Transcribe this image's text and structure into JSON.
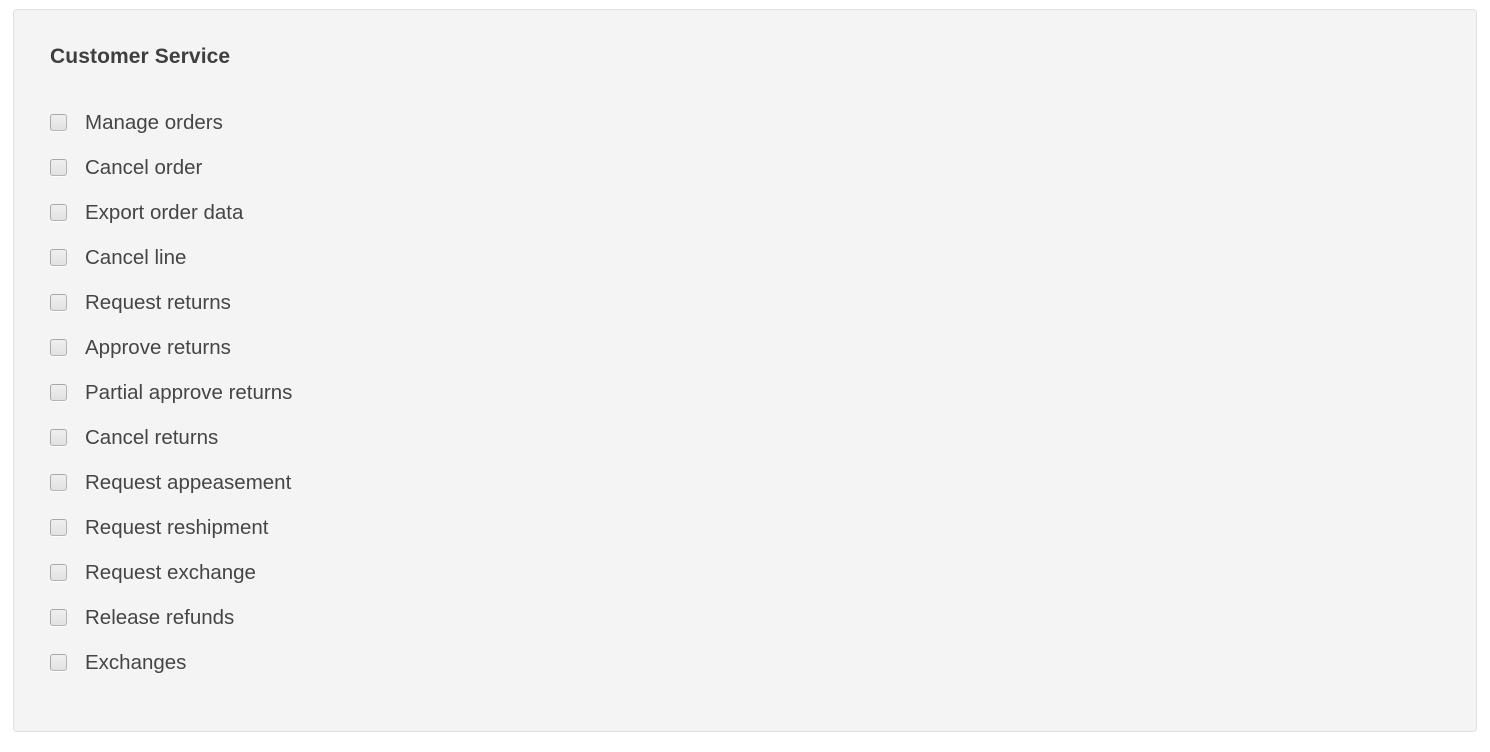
{
  "panel": {
    "title": "Customer Service",
    "background_color": "#f4f4f4",
    "border_color": "#e0e0e0",
    "title_color": "#3f3f3f",
    "label_color": "#454545",
    "checkbox_border_color": "#b4b4b4",
    "checkbox_fill_color": "#e6e6e6",
    "permissions": [
      {
        "label": "Manage orders",
        "checked": false
      },
      {
        "label": "Cancel order",
        "checked": false
      },
      {
        "label": "Export order data",
        "checked": false
      },
      {
        "label": "Cancel line",
        "checked": false
      },
      {
        "label": "Request returns",
        "checked": false
      },
      {
        "label": "Approve returns",
        "checked": false
      },
      {
        "label": "Partial approve returns",
        "checked": false
      },
      {
        "label": "Cancel returns",
        "checked": false
      },
      {
        "label": "Request appeasement",
        "checked": false
      },
      {
        "label": "Request reshipment",
        "checked": false
      },
      {
        "label": "Request exchange",
        "checked": false
      },
      {
        "label": "Release refunds",
        "checked": false
      },
      {
        "label": "Exchanges",
        "checked": false
      }
    ]
  }
}
